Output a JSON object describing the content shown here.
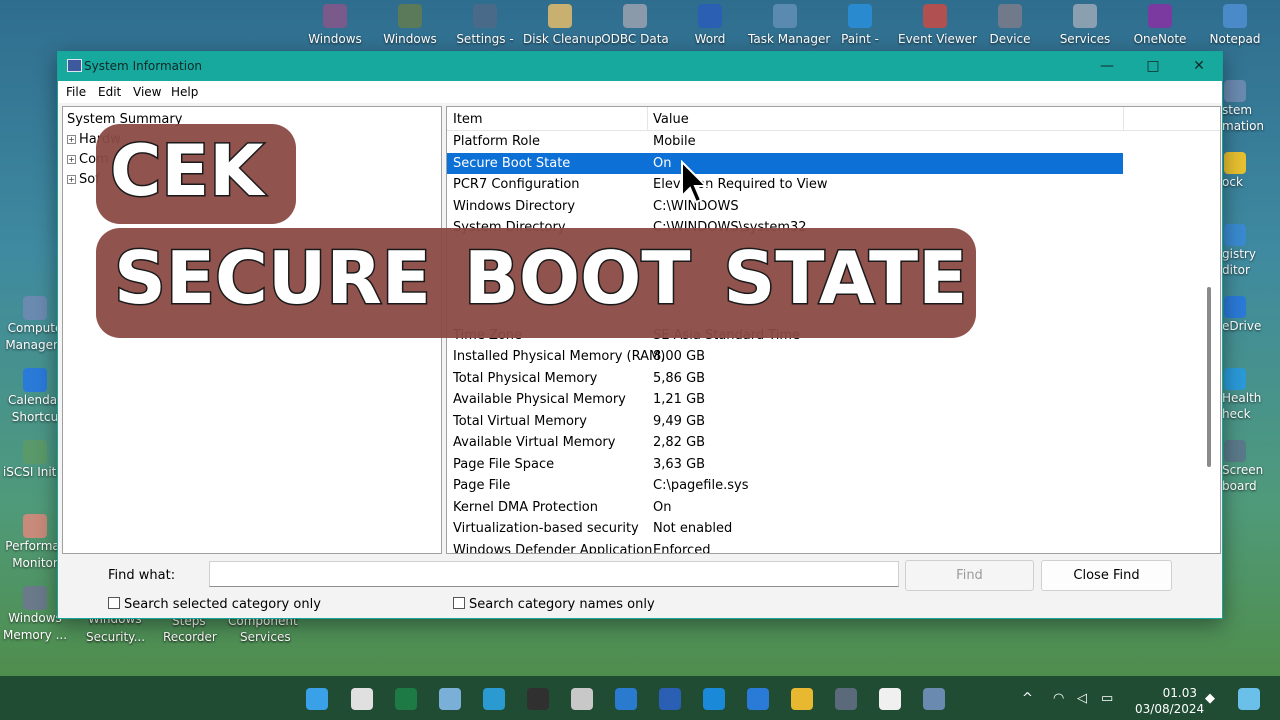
{
  "desktop": {
    "top_icons": [
      {
        "label": "Windows",
        "color": "#7a5a8a"
      },
      {
        "label": "Windows",
        "color": "#5a7a5a"
      },
      {
        "label": "Settings -",
        "color": "#4a6a8a"
      },
      {
        "label": "Disk Cleanup",
        "color": "#c8b070"
      },
      {
        "label": "ODBC Data",
        "color": "#8a9aaa"
      },
      {
        "label": "Word",
        "color": "#2b5fb3"
      },
      {
        "label": "Task Manager",
        "color": "#5a8ab0"
      },
      {
        "label": "Paint -",
        "color": "#2a8ad0"
      },
      {
        "label": "Event Viewer",
        "color": "#b05050"
      },
      {
        "label": "Device",
        "color": "#707a8a"
      },
      {
        "label": "Services",
        "color": "#8aa0b0"
      },
      {
        "label": "OneNote",
        "color": "#7a3aa0"
      },
      {
        "label": "Notepad",
        "color": "#4a8ac8"
      }
    ],
    "left_icons": [
      {
        "label1": "Compute",
        "label2": "Managem"
      },
      {
        "label1": "Calendar",
        "label2": "Shortcu"
      },
      {
        "label1": "iSCSI Initia",
        "label2": ""
      },
      {
        "label1": "Performar",
        "label2": "Monitor"
      },
      {
        "label1": "Windows",
        "label2": "Memory ..."
      }
    ],
    "right_icons": [
      {
        "label1": "stem",
        "label2": "mation"
      },
      {
        "label1": "ock",
        "label2": ""
      },
      {
        "label1": "gistry",
        "label2": "ditor"
      },
      {
        "label1": "eDrive",
        "label2": ""
      },
      {
        "label1": "Health",
        "label2": "heck"
      },
      {
        "label1": "Screen",
        "label2": "board"
      }
    ],
    "bottom_peek": [
      "Windows",
      "Security...",
      "Steps",
      "Recorder",
      "Component",
      "Services"
    ]
  },
  "window": {
    "title": "System Information",
    "controls": {
      "minimize": "—",
      "maximize": "□",
      "close": "✕"
    },
    "menu": [
      "File",
      "Edit",
      "View",
      "Help"
    ],
    "tree": {
      "root": "System Summary",
      "children": [
        "Hardw",
        "Com",
        "Sof"
      ]
    },
    "list": {
      "headers": {
        "item": "Item",
        "value": "Value"
      },
      "selected_index": 1,
      "rows": [
        {
          "item": "Platform Role",
          "value": "Mobile"
        },
        {
          "item": "Secure Boot State",
          "value": "On"
        },
        {
          "item": "PCR7 Configuration",
          "value": "Elevation Required to View"
        },
        {
          "item": "Windows Directory",
          "value": "C:\\WINDOWS"
        },
        {
          "item": "System Directory",
          "value": "C:\\WINDOWS\\system32"
        },
        {
          "item": "",
          "value": ""
        },
        {
          "item": "",
          "value": ""
        },
        {
          "item": "",
          "value": ""
        },
        {
          "item": "",
          "value": ""
        },
        {
          "item": "Time Zone",
          "value": "SE Asia Standard Time"
        },
        {
          "item": "Installed Physical Memory (RAM)",
          "value": "8,00 GB"
        },
        {
          "item": "Total Physical Memory",
          "value": "5,86 GB"
        },
        {
          "item": "Available Physical Memory",
          "value": "1,21 GB"
        },
        {
          "item": "Total Virtual Memory",
          "value": "9,49 GB"
        },
        {
          "item": "Available Virtual Memory",
          "value": "2,82 GB"
        },
        {
          "item": "Page File Space",
          "value": "3,63 GB"
        },
        {
          "item": "Page File",
          "value": "C:\\pagefile.sys"
        },
        {
          "item": "Kernel DMA Protection",
          "value": "On"
        },
        {
          "item": "Virtualization-based security",
          "value": "Not enabled"
        },
        {
          "item": "Windows Defender Application",
          "value": "Enforced"
        }
      ]
    },
    "find": {
      "label": "Find what:",
      "value": "",
      "find_button": "Find",
      "close_find_button": "Close Find",
      "check_selected_category": "Search selected category only",
      "check_category_names": "Search category names only"
    }
  },
  "overlay": {
    "line1": "CEK",
    "line2": "SECURE BOOT STATE",
    "bg_color": "#8a4a45"
  },
  "taskbar": {
    "time": "01.03",
    "date": "03/08/2024",
    "icons": [
      {
        "name": "start",
        "color": "#3aa0e8"
      },
      {
        "name": "search",
        "color": "#e0e0e0"
      },
      {
        "name": "excel",
        "color": "#1d7a44"
      },
      {
        "name": "photos",
        "color": "#7ab0d8"
      },
      {
        "name": "browser",
        "color": "#2a9ad0"
      },
      {
        "name": "recorder",
        "color": "#303030"
      },
      {
        "name": "clock",
        "color": "#c8c8c8"
      },
      {
        "name": "paint",
        "color": "#2a7ad0"
      },
      {
        "name": "word",
        "color": "#2b5fb3"
      },
      {
        "name": "monitor",
        "color": "#1a8ad8"
      },
      {
        "name": "calendar",
        "color": "#2a7ad8"
      },
      {
        "name": "explorer",
        "color": "#e8b830"
      },
      {
        "name": "terminal",
        "color": "#5a6a7a"
      },
      {
        "name": "store",
        "color": "#f0f0f0"
      },
      {
        "name": "sysinfo",
        "color": "#6a8ab0"
      }
    ]
  }
}
